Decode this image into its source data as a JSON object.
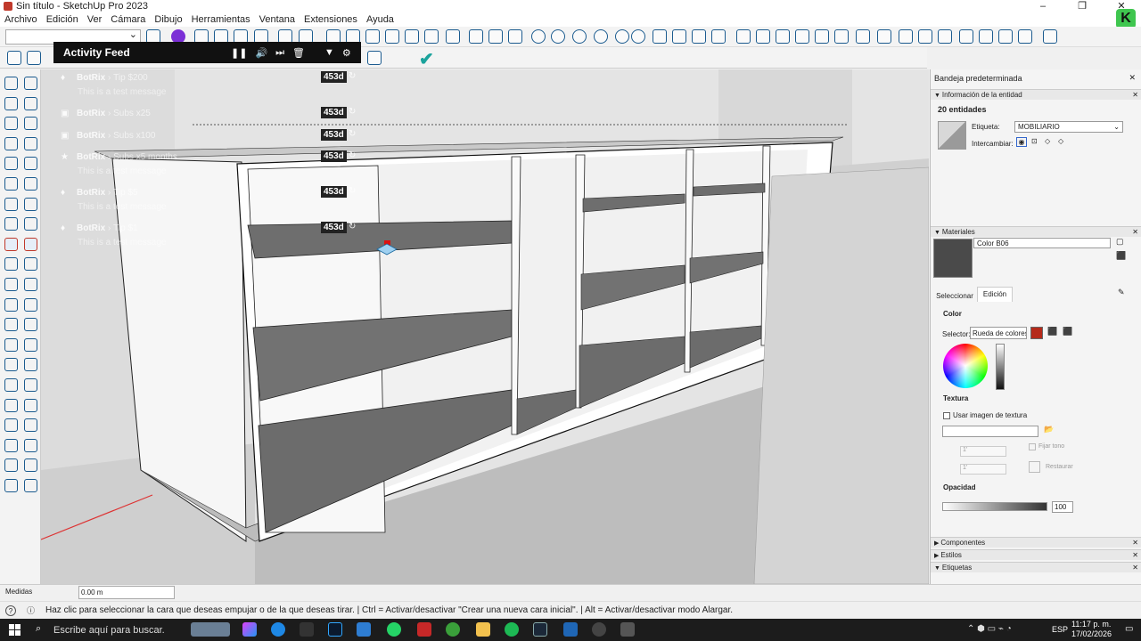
{
  "window": {
    "title": "Sin título - SketchUp Pro 2023"
  },
  "menu": [
    "Archivo",
    "Edición",
    "Ver",
    "Cámara",
    "Dibujo",
    "Herramientas",
    "Ventana",
    "Extensiones",
    "Ayuda"
  ],
  "activity_feed": {
    "title": "Activity Feed",
    "events": [
      {
        "user": "BotRix",
        "action": "Tip $200",
        "message": "This is a test message",
        "age": "453d",
        "icon": "tip-icon"
      },
      {
        "user": "BotRix",
        "action": "Subs x25",
        "message": "",
        "age": "453d",
        "icon": "gift-icon"
      },
      {
        "user": "BotRix",
        "action": "Subs x100",
        "message": "",
        "age": "453d",
        "icon": "gift-icon"
      },
      {
        "user": "BotRix",
        "action": "Subs x5 months",
        "message": "This is a test message",
        "age": "453d",
        "icon": "star-icon"
      },
      {
        "user": "BotRix",
        "action": "Tip $5",
        "message": "This is a test message",
        "age": "453d",
        "icon": "tip-icon"
      },
      {
        "user": "BotRix",
        "action": "Tip $1",
        "message": "This is a test message",
        "age": "453d",
        "icon": "tip-icon"
      }
    ]
  },
  "tray": {
    "title": "Bandeja predeterminada",
    "entity_info": {
      "header": "Información de la entidad",
      "count": "20 entidades",
      "tag_label": "Etiqueta:",
      "tag_value": "MOBILIARIO",
      "swap_label": "Intercambiar:"
    },
    "materials": {
      "header": "Materiales",
      "name": "Color B06",
      "tabs": [
        "Seleccionar",
        "Edición"
      ],
      "color_label": "Color",
      "selector_label": "Selector:",
      "selector_value": "Rueda de colores",
      "texture_label": "Textura",
      "use_texture": "Usar imagen de textura",
      "width_value": "1'",
      "height_value": "1'",
      "fix_hue": "Fijar tono",
      "restore": "Restaurar",
      "opacity_label": "Opacidad",
      "opacity_value": "100",
      "swatch_color": "#4a4a4a",
      "picker_color": "#b5291a"
    },
    "collapsed": [
      "Componentes",
      "Estilos",
      "Etiquetas"
    ]
  },
  "measure": {
    "label": "Medidas",
    "value": "0.00 m"
  },
  "status": {
    "text": "Haz clic para seleccionar la cara que deseas empujar o de la que deseas tirar. | Ctrl = Activar/desactivar \"Crear una nueva cara inicial\". | Alt = Activar/desactivar modo Alargar."
  },
  "taskbar": {
    "search": "Escribe aquí para buscar.",
    "lang": "ESP",
    "time": "11:17 p. m.",
    "date": "17/02/2026"
  }
}
